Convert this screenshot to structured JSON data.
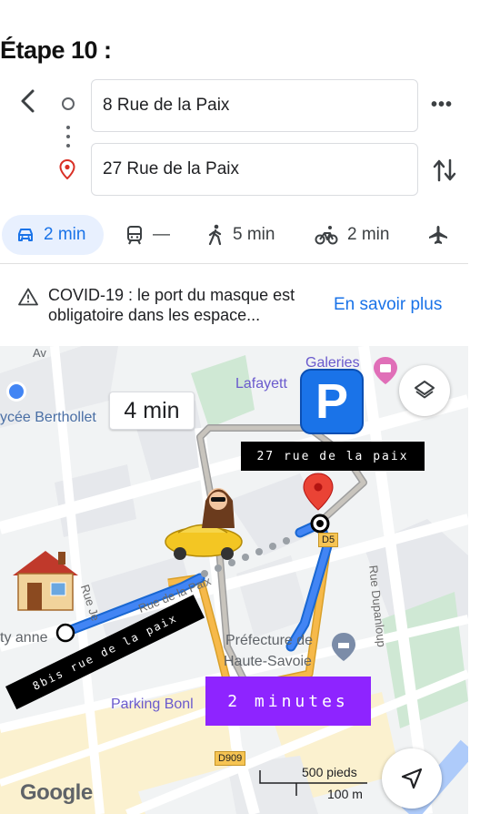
{
  "step_title": "Étape 10 :",
  "search": {
    "origin": "8 Rue de la Paix",
    "destination": "27 Rue de la Paix",
    "more_label": "•••"
  },
  "modes": {
    "car": "2 min",
    "transit": "—",
    "walk": "5 min",
    "bike": "2 min"
  },
  "notice": {
    "text": "COVID-19 : le port du masque est obligatoire dans les espace...",
    "link": "En savoir plus"
  },
  "map": {
    "eta": "4 min",
    "parking_letter": "P",
    "labels": {
      "galeries": "Galeries",
      "lafayette": "Lafayett",
      "lycee": "ycée Berthollet",
      "prefecture_1": "Préfecture de",
      "prefecture_2": "Haute-Savoie",
      "parking": "Parking Bonl",
      "rue_dupanloup": "Rue Dupanloup",
      "rue_de_la_paix": "Rue de la Paix",
      "rue_je": "Rue Je",
      "city_annex": "ty anne",
      "av": "Av"
    },
    "destination_label": "27 rue de la paix",
    "origin_label": "8bis rue de la paix",
    "duration_label": "2 minutes",
    "road_d909": "D909",
    "road_d5": "D5",
    "google": "Google",
    "scale_ft": "500 pieds",
    "scale_m": "100 m"
  },
  "colors": {
    "accent": "#1a73e8",
    "route_blue": "#4285f4",
    "route_orange": "#f4b400",
    "duration_purple": "#8e24ff",
    "pin_red": "#ea4335"
  }
}
